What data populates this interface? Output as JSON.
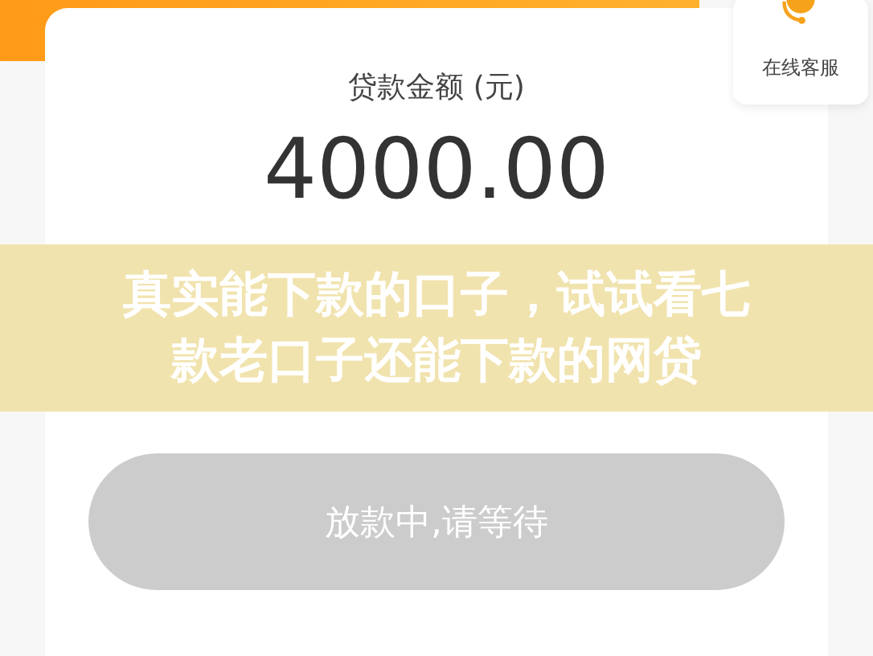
{
  "loan_card": {
    "label": "贷款金额 (元)",
    "amount": "4000.00"
  },
  "customer_service": {
    "label": "在线客服"
  },
  "overlay_banner": {
    "lines": [
      "真实能下款的口子，试试看七",
      "款老口子还能下款的网贷"
    ]
  },
  "status_button": {
    "label": "放款中,请等待",
    "disabled": true
  }
}
